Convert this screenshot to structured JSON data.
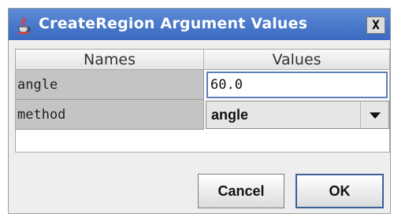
{
  "window": {
    "title": "CreateRegion Argument Values",
    "close_label": "X",
    "icon": "java-coffee-cup-icon"
  },
  "table": {
    "headers": {
      "names": "Names",
      "values": "Values"
    },
    "rows": [
      {
        "name": "angle",
        "value": "60.0",
        "control": "text-input"
      },
      {
        "name": "method",
        "value": "angle",
        "control": "dropdown"
      }
    ]
  },
  "buttons": {
    "cancel": "Cancel",
    "ok": "OK"
  },
  "colors": {
    "titlebar": "#3a69c0",
    "dialog_bg": "#eeeeee",
    "row_label_bg": "#c4c4c4",
    "focus_border": "#5b7fb8"
  }
}
